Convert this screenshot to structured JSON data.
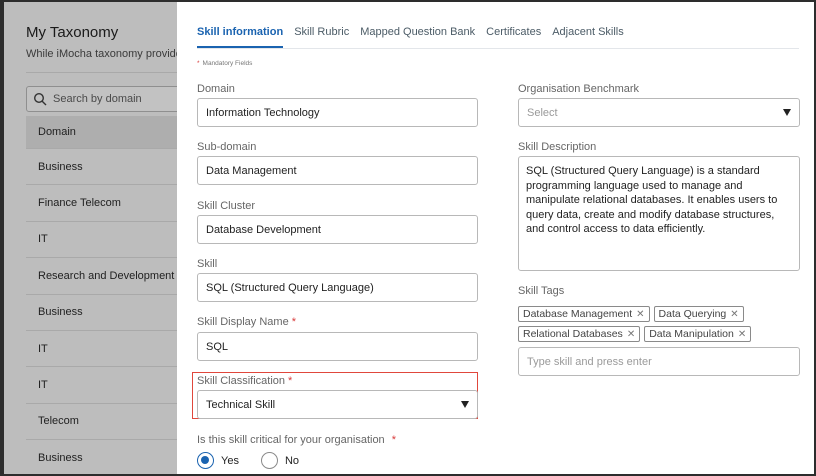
{
  "background": {
    "title": "My Taxonomy",
    "subtitle": "While iMocha taxonomy provides",
    "search_placeholder": "Search by domain",
    "list": [
      "Domain",
      "Business",
      "Finance Telecom",
      "IT",
      "Research and Development",
      "Business",
      "IT",
      "IT",
      "Telecom",
      "Business"
    ]
  },
  "tabs": [
    "Skill information",
    "Skill Rubric",
    "Mapped Question Bank",
    "Certificates",
    "Adjacent Skills"
  ],
  "mandatory_note": "Mandatory Fields",
  "form": {
    "domain": {
      "label": "Domain",
      "value": "Information Technology"
    },
    "subdomain": {
      "label": "Sub-domain",
      "value": "Data Management"
    },
    "cluster": {
      "label": "Skill Cluster",
      "value": "Database Development"
    },
    "skill": {
      "label": "Skill",
      "value": "SQL (Structured Query Language)"
    },
    "display_name": {
      "label": "Skill Display Name",
      "value": "SQL",
      "required_mark": "*"
    },
    "classification": {
      "label": "Skill Classification",
      "value": "Technical Skill",
      "required_mark": "*"
    },
    "critical": {
      "label": "Is this skill critical for your organisation",
      "required_mark": "*",
      "options": [
        "Yes",
        "No"
      ],
      "selected": "Yes"
    },
    "benchmark": {
      "label": "Organisation Benchmark",
      "placeholder": "Select"
    },
    "description": {
      "label": "Skill Description",
      "value": "SQL (Structured Query Language) is a standard programming language used to manage and manipulate relational databases. It enables users to query data, create and modify database structures, and control access to data efficiently."
    },
    "tags": {
      "label": "Skill Tags",
      "items": [
        "Database Management",
        "Data Querying",
        "Relational Databases",
        "Data Manipulation"
      ],
      "placeholder": "Type skill and press enter"
    }
  },
  "colors": {
    "accent": "#1a63b0",
    "required": "#d83a3a",
    "highlight": "#e0473c"
  }
}
